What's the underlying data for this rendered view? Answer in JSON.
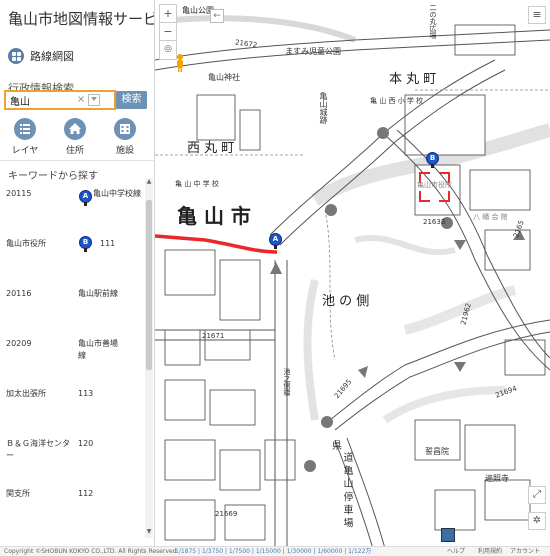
{
  "app": {
    "title": "亀山市地図情報サービス"
  },
  "nav": {
    "route_map_label": "路線網図"
  },
  "search": {
    "section_label": "行政情報検索",
    "value": "亀山",
    "clear_label": "×",
    "button_label": "検索"
  },
  "tools": [
    {
      "label": "レイヤ",
      "icon": "layers-icon"
    },
    {
      "label": "住所",
      "icon": "home-icon"
    },
    {
      "label": "施設",
      "icon": "building-icon"
    }
  ],
  "keyword_label": "キーワードから探す",
  "results": [
    {
      "code": "20115",
      "name": "亀山中学校線",
      "marker": "A"
    },
    {
      "code": "亀山市役所",
      "name": "111",
      "marker": "B"
    },
    {
      "code": "20116",
      "name": "亀山駅前線",
      "marker": ""
    },
    {
      "code": "20209",
      "name": "亀山市善場線",
      "marker": ""
    },
    {
      "code": "加太出張所",
      "name": "113",
      "marker": ""
    },
    {
      "code": "Ｂ＆Ｇ海洋センター",
      "name": "120",
      "marker": ""
    },
    {
      "code": "関支所",
      "name": "112",
      "marker": ""
    }
  ],
  "map": {
    "labels": {
      "kameyama_park": "亀山公園",
      "honmaru": "本 丸 町",
      "nishimaru": "西 丸 町",
      "kameyama_city": "亀 山 市",
      "ikenogawa": "池 の 側",
      "kameyama_shrine": "亀山神社",
      "masumi_park": "ますみ児童公園",
      "kameyama_castle": "亀山城跡",
      "west_school": "亀 山 西 小 学 校",
      "mid_school": "亀 山 中 学 校",
      "city_hall": "亀山市役所",
      "hassho": "八 幡 会 館",
      "ninomaru_square": "二の丸広場",
      "ikenogawa_bridge": "池之側橋",
      "ken": "県",
      "kameyama_line": "道 亀 山 停 車 場",
      "temple": "誓昌院",
      "henshouji": "遍照寺",
      "num_21672": "21672",
      "num_21633": "21633",
      "num_21671": "21671",
      "num_21695": "21695",
      "num_21694": "21694",
      "num_21669": "21669",
      "num_21962": "21962",
      "num_2165": "2165"
    },
    "markers": {
      "a": "A",
      "b": "B"
    },
    "footer": {
      "scale": "1/1875 | 1/3750 | 1/7500 | 1/15000 | 1/30000 | 1/60000 | 1/122万",
      "copyright": "Copyright ©SHOBUN KOKYO CO.,LTD. All Rights Reserved",
      "help": "ヘルプ",
      "terms": "利用規約",
      "account": "アカウント",
      "usage": "利用規約"
    }
  }
}
